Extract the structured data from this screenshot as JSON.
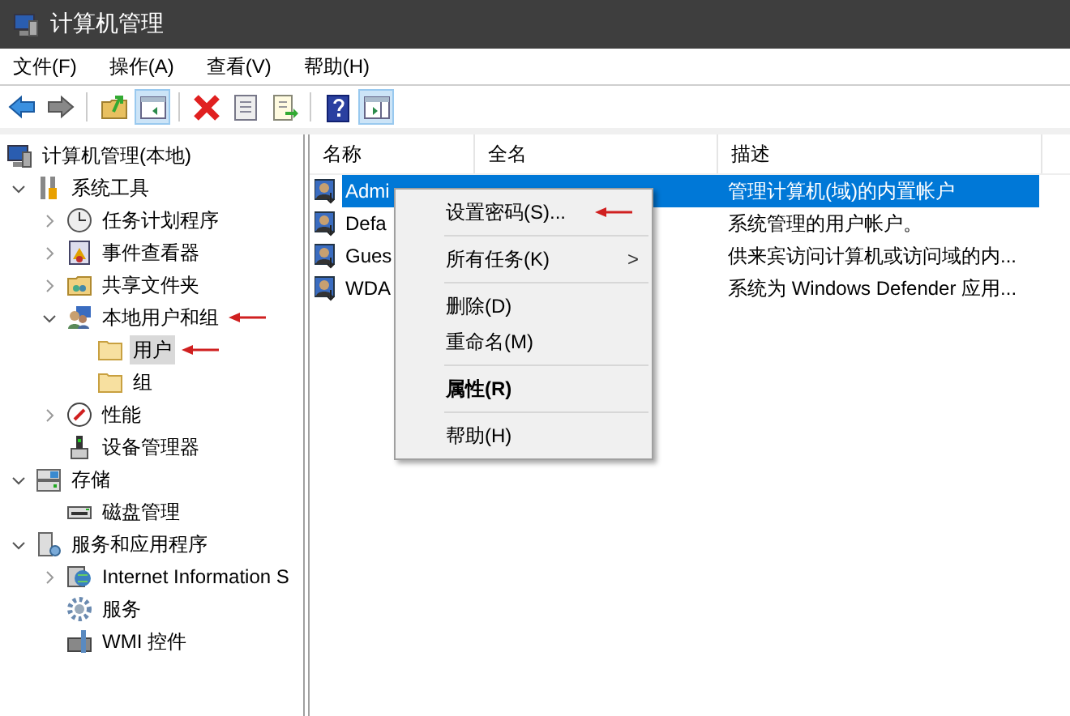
{
  "window": {
    "title": "计算机管理"
  },
  "menu": [
    {
      "label": "文件(F)"
    },
    {
      "label": "操作(A)"
    },
    {
      "label": "查看(V)"
    },
    {
      "label": "帮助(H)"
    }
  ],
  "toolbar": [
    {
      "kind": "back",
      "pressed": false
    },
    {
      "kind": "forward",
      "pressed": false
    },
    {
      "kind": "sep"
    },
    {
      "kind": "up",
      "pressed": false
    },
    {
      "kind": "tree",
      "pressed": true
    },
    {
      "kind": "sep"
    },
    {
      "kind": "delete",
      "pressed": false
    },
    {
      "kind": "properties",
      "pressed": false
    },
    {
      "kind": "export",
      "pressed": false
    },
    {
      "kind": "sep"
    },
    {
      "kind": "help",
      "pressed": false
    },
    {
      "kind": "action",
      "pressed": true
    }
  ],
  "tree": [
    {
      "label": "计算机管理(本地)",
      "selected": false,
      "marked": false,
      "children": [
        {
          "label": "系统工具",
          "expanded": true,
          "selected": false,
          "marked": false,
          "children": [
            {
              "label": "任务计划程序",
              "expanded": false,
              "selected": false,
              "marked": false
            },
            {
              "label": "事件查看器",
              "expanded": false,
              "selected": false,
              "marked": false
            },
            {
              "label": "共享文件夹",
              "expanded": false,
              "selected": false,
              "marked": false
            },
            {
              "label": "本地用户和组",
              "expanded": true,
              "selected": false,
              "marked": true,
              "children": [
                {
                  "label": "用户",
                  "selected": true,
                  "marked": true
                },
                {
                  "label": "组",
                  "selected": false,
                  "marked": false
                }
              ]
            },
            {
              "label": "性能",
              "expanded": false,
              "selected": false,
              "marked": false
            },
            {
              "label": "设备管理器",
              "selected": false,
              "marked": false
            }
          ]
        },
        {
          "label": "存储",
          "expanded": true,
          "selected": false,
          "marked": false,
          "children": [
            {
              "label": "磁盘管理",
              "selected": false,
              "marked": false
            }
          ]
        },
        {
          "label": "服务和应用程序",
          "expanded": true,
          "selected": false,
          "marked": false,
          "children": [
            {
              "label": "Internet Information S",
              "expanded": false,
              "selected": false,
              "marked": false
            },
            {
              "label": "服务",
              "selected": false,
              "marked": false
            },
            {
              "label": "WMI 控件",
              "selected": false,
              "marked": false
            }
          ]
        }
      ]
    }
  ],
  "table": {
    "columns": [
      "名称",
      "全名",
      "描述"
    ],
    "rows": [
      {
        "name": "Admi",
        "description": "管理计算机(域)的内置帐户",
        "selected": true
      },
      {
        "name": "Defa",
        "description": "系统管理的用户帐户。",
        "selected": false
      },
      {
        "name": "Gues",
        "description": "供来宾访问计算机或访问域的内...",
        "selected": false
      },
      {
        "name": "WDA",
        "description": "系统为 Windows Defender 应用...",
        "selected": false
      }
    ]
  },
  "context_menu": [
    {
      "kind": "item",
      "label": "设置密码(S)...",
      "marked": true
    },
    {
      "kind": "sep"
    },
    {
      "kind": "submenu",
      "label": "所有任务(K)",
      "arrow": ">"
    },
    {
      "kind": "sep"
    },
    {
      "kind": "item",
      "label": "删除(D)",
      "marked": false
    },
    {
      "kind": "item",
      "label": "重命名(M)",
      "marked": false
    },
    {
      "kind": "sep"
    },
    {
      "kind": "default",
      "label": "属性(R)",
      "marked": false
    },
    {
      "kind": "sep"
    },
    {
      "kind": "item",
      "label": "帮助(H)",
      "marked": false
    }
  ]
}
